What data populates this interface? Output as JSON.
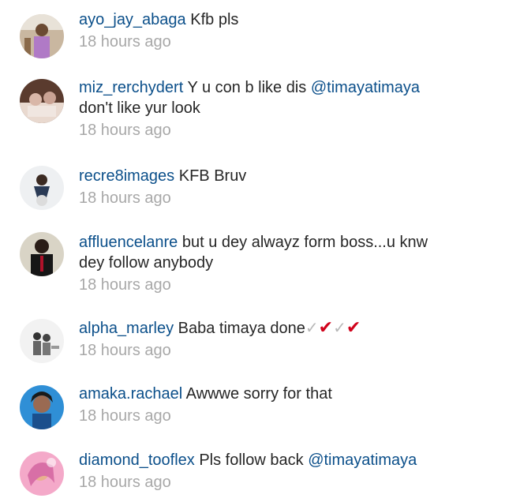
{
  "comments": [
    {
      "username": "ayo_jay_abaga",
      "text": "Kfb pls",
      "mention": "",
      "text_after": "",
      "time": "18 hours ago",
      "avatar": "avatar-photo"
    },
    {
      "username": "miz_rerchydert",
      "text": "Y u con b like dis",
      "mention": "@timayatimaya",
      "text_after": "don't like yur look",
      "time": "18 hours ago",
      "avatar": "avatar-photo"
    },
    {
      "username": "recre8images",
      "text": "KFB Bruv",
      "mention": "",
      "text_after": "",
      "time": "18 hours ago",
      "avatar": "avatar-photo"
    },
    {
      "username": "affluencelanre",
      "text": "but u dey alwayz form boss...u knw",
      "mention": "",
      "text_after": "dey follow anybody",
      "time": "18 hours ago",
      "avatar": "avatar-photo"
    },
    {
      "username": "alpha_marley",
      "text": "Baba timaya done",
      "mention": "",
      "text_after": "",
      "time": "18 hours ago",
      "avatar": "avatar-photo",
      "checks": "✓✔✓✔"
    },
    {
      "username": "amaka.rachael",
      "text": "Awwwe sorry for that",
      "mention": "",
      "text_after": "",
      "time": "18 hours ago",
      "avatar": "avatar-photo"
    },
    {
      "username": "diamond_tooflex",
      "text": "Pls follow back",
      "mention": "@timayatimaya",
      "text_after": "",
      "time": "18 hours ago",
      "avatar": "avatar-photo"
    }
  ],
  "colors": {
    "username": "#0b4f8a",
    "mention": "#0b4f8a",
    "text": "#262626",
    "time": "#a8a8a8",
    "check_red": "#d0021b"
  }
}
